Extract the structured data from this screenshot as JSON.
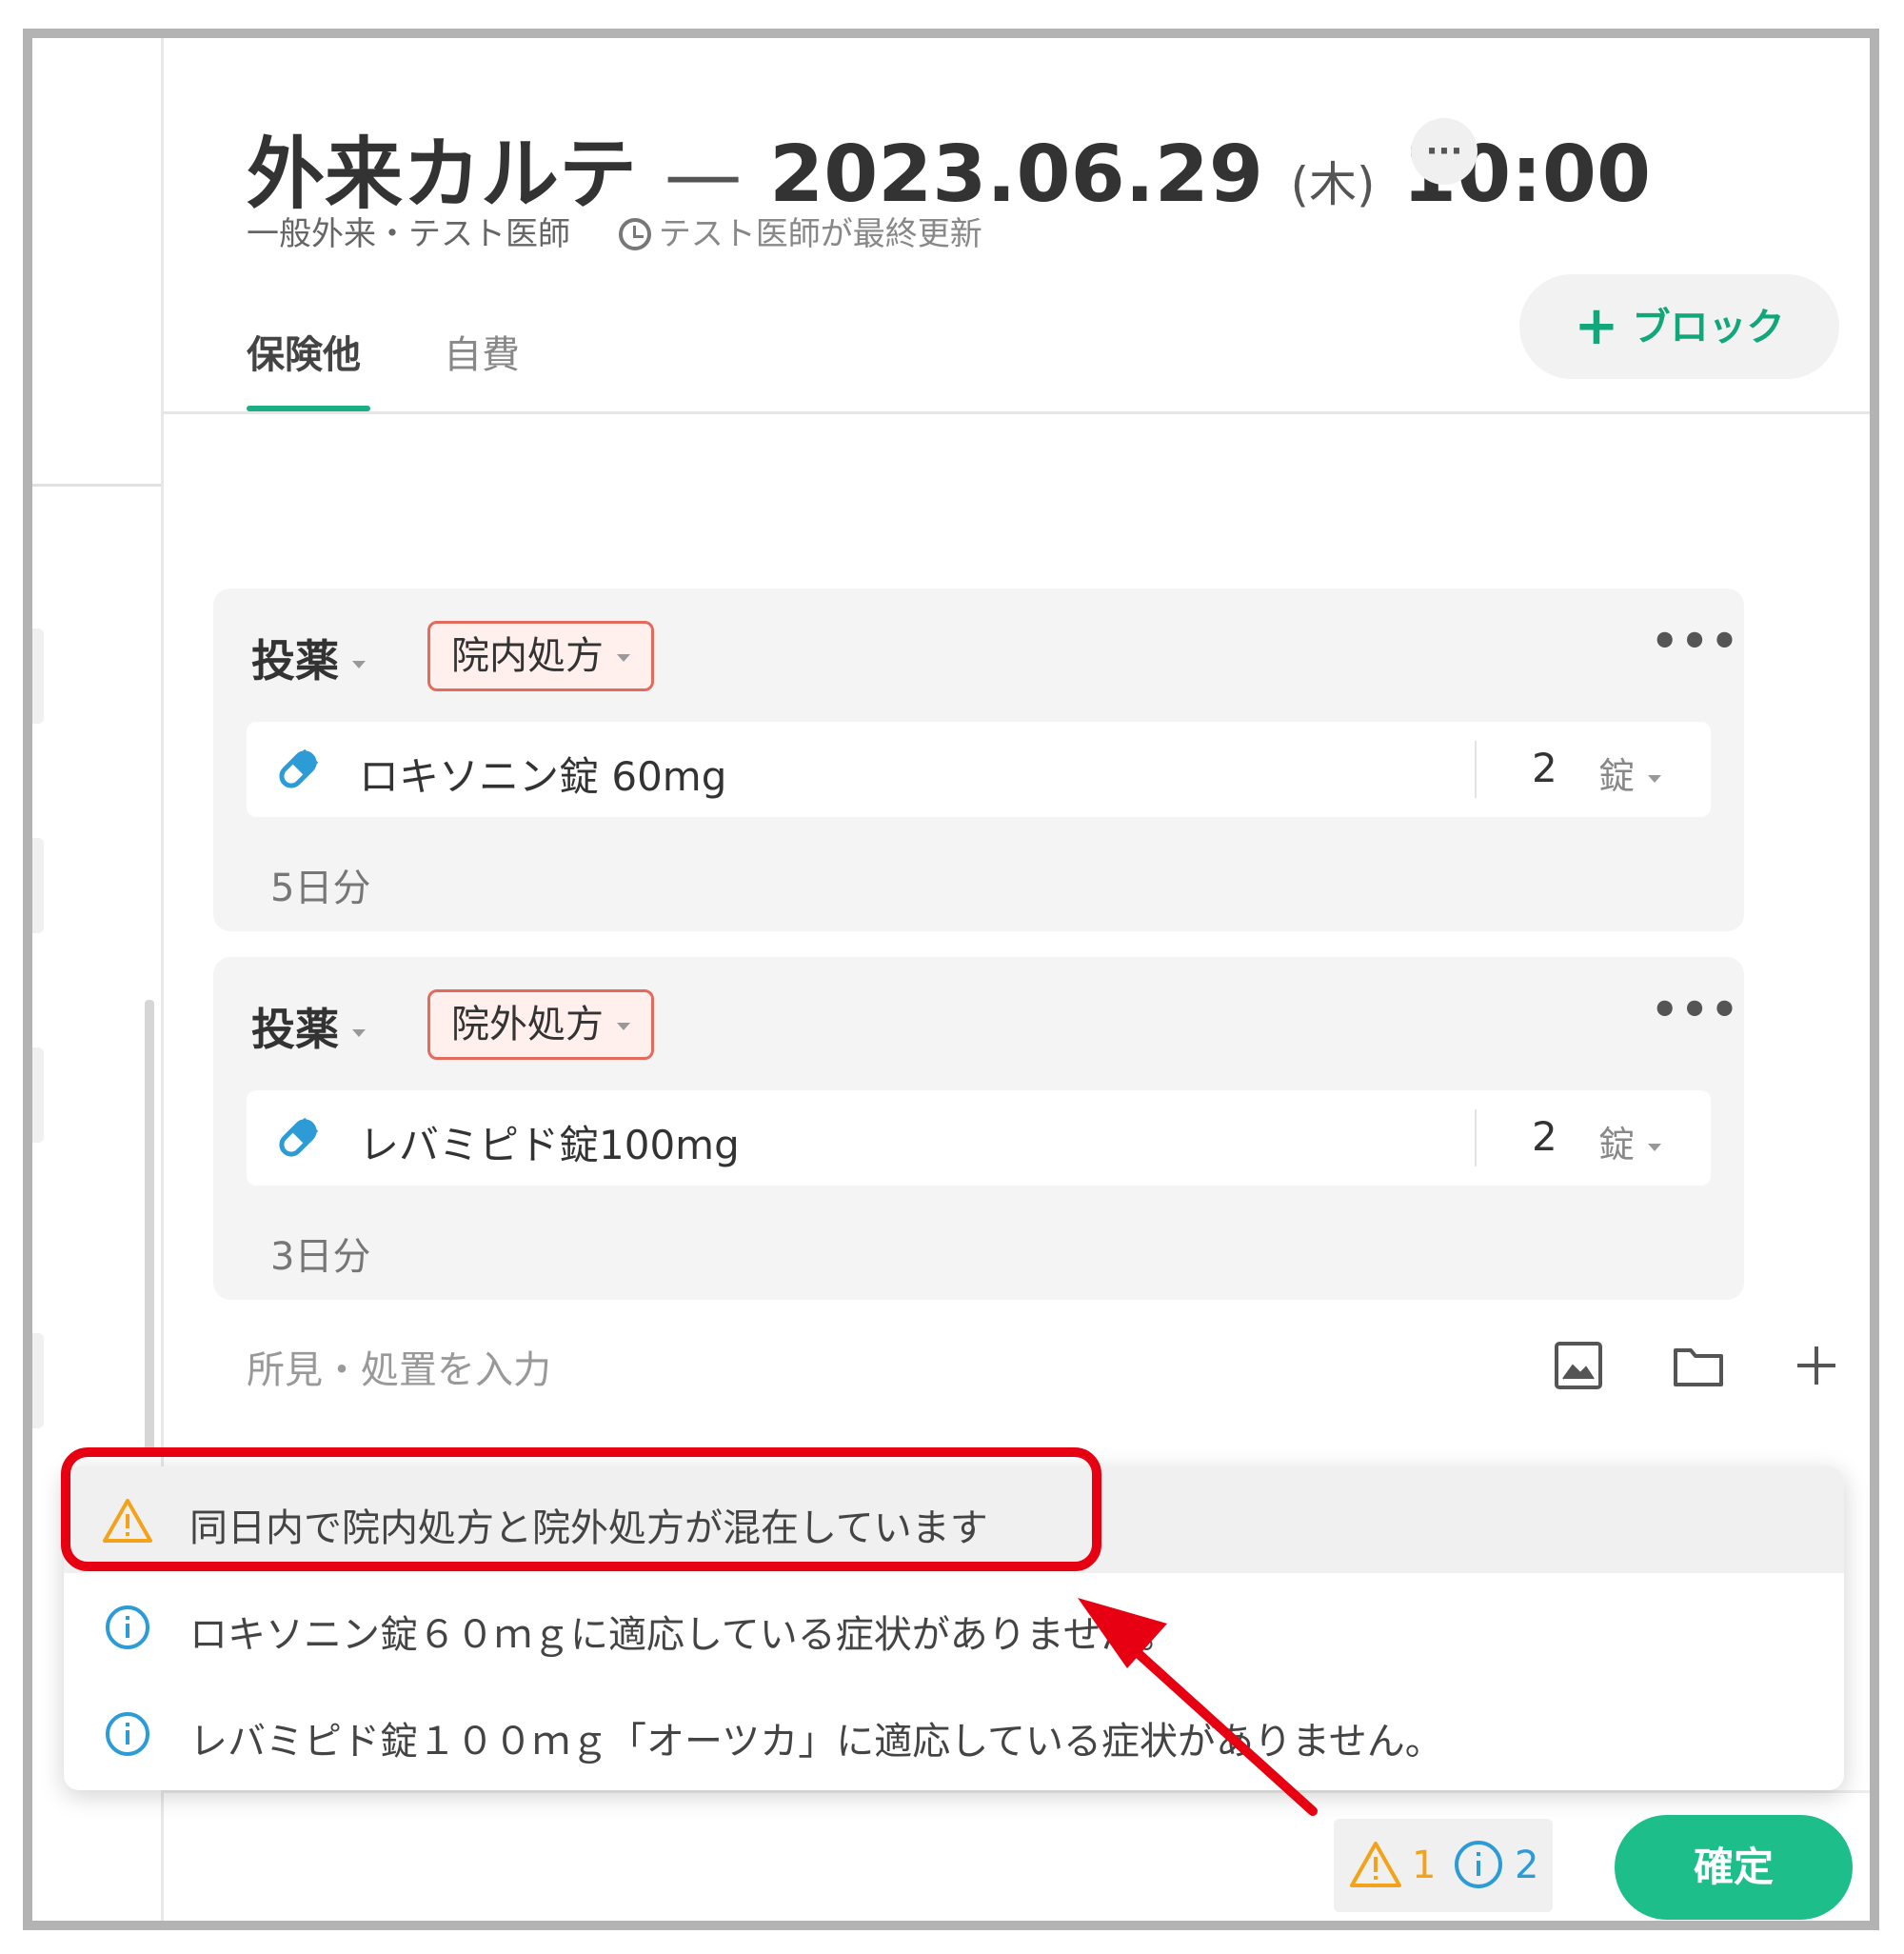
{
  "header": {
    "title": "外来カルテ",
    "title_dash": "—",
    "date": "2023.06.29",
    "weekday": "(木)",
    "time": "10:00",
    "more_label": "···",
    "department": "一般外来・テスト医師",
    "last_updated": "テスト医師が最終更新"
  },
  "tabs": [
    {
      "label": "保険他",
      "active": true
    },
    {
      "label": "自費",
      "active": false
    }
  ],
  "add_block": {
    "icon": "plus-icon",
    "label": "ブロック"
  },
  "blocks": [
    {
      "label": "投薬",
      "rx_type": "院内処方",
      "more_label": "•••",
      "drug_name": "ロキソニン錠 60mg",
      "quantity": "2",
      "unit": "錠",
      "days": "5日分"
    },
    {
      "label": "投薬",
      "rx_type": "院外処方",
      "more_label": "•••",
      "drug_name": "レバミピド錠100mg",
      "quantity": "2",
      "unit": "錠",
      "days": "3日分"
    }
  ],
  "composer": {
    "placeholder": "所見・処置を入力",
    "icons": [
      "image-icon",
      "folder-icon",
      "plus-icon"
    ]
  },
  "alerts": [
    {
      "type": "warning",
      "icon": "warning-triangle-icon",
      "text": "同日内で院内処方と院外処方が混在しています"
    },
    {
      "type": "info",
      "icon": "info-circle-icon",
      "text": "ロキソニン錠６０ｍｇに適応している症状がありません。"
    },
    {
      "type": "info",
      "icon": "info-circle-icon",
      "text": "レバミピド錠１００ｍｇ「オーツカ」に適応している症状がありません。"
    }
  ],
  "status": {
    "warning_count": "1",
    "info_count": "2"
  },
  "confirm_label": "確定",
  "colors": {
    "accent_green": "#1ebe8a",
    "tab_underline": "#1aae85",
    "warning": "#f3a31b",
    "info": "#2d9bd6",
    "annotation_red": "#e60012",
    "rx_tag_border": "#e36b5d"
  }
}
